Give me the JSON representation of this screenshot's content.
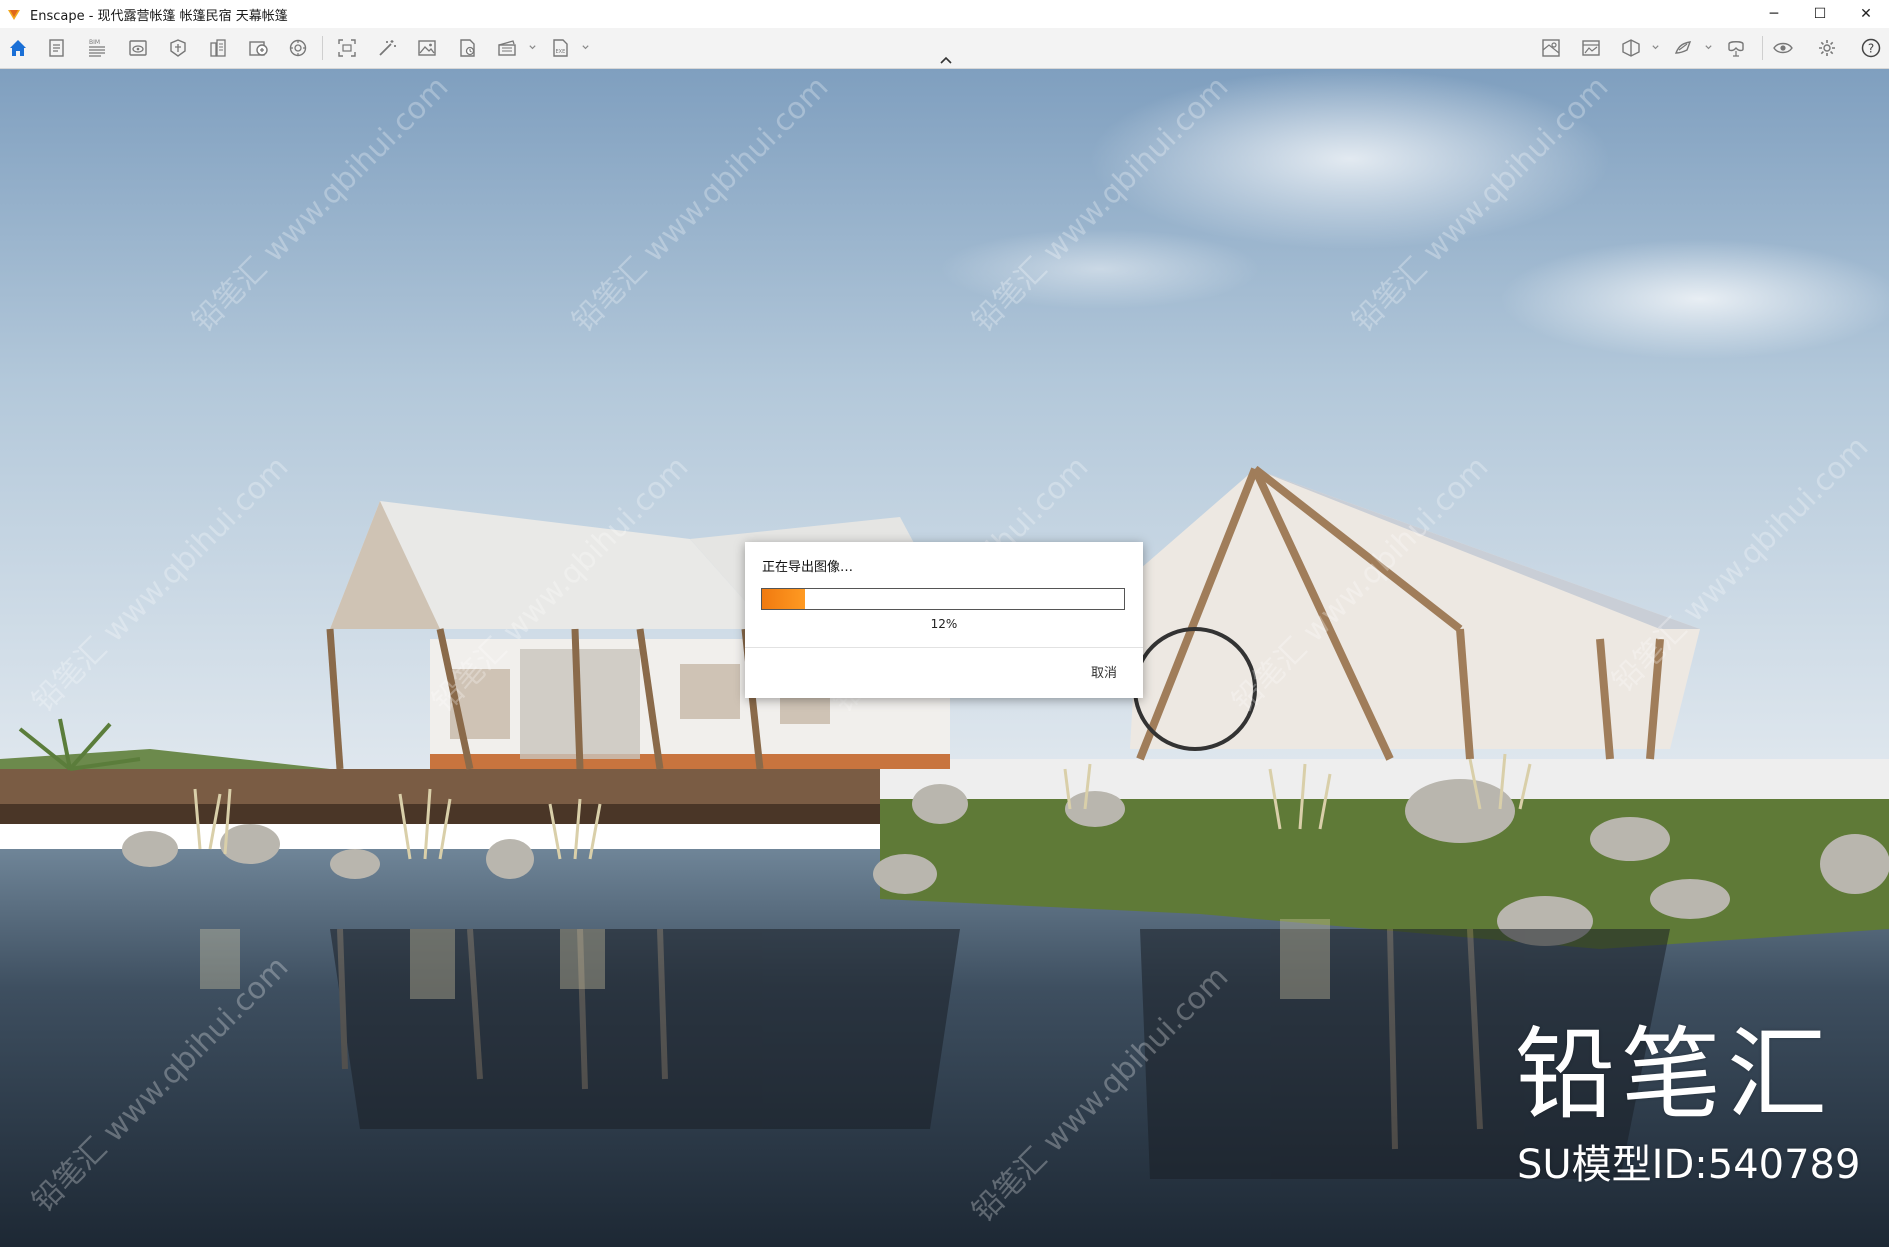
{
  "window": {
    "title": "Enscape - 现代露营帐篷 帐篷民宿 天幕帐篷",
    "controls": {
      "minimize": "─",
      "maximize": "☐",
      "close": "✕"
    }
  },
  "toolbar": {
    "left_icons": [
      "home-icon",
      "document-icon",
      "bim-list-icon",
      "view-icon",
      "asset-library-icon",
      "atlas-icon",
      "material-icon",
      "atmosphere-icon",
      "screenshot-icon",
      "magic-wand-icon",
      "image-export-icon",
      "batch-render-icon",
      "video-export-icon",
      "exe-export-icon"
    ],
    "right_icons": [
      "settings-map-icon",
      "visual-settings-icon",
      "cube-icon",
      "sketch-icon",
      "vr-icon",
      "eye-icon",
      "gear-icon",
      "help-icon"
    ],
    "help_label": "?",
    "bim_label": "BIM",
    "exe_label": "EXE",
    "accent_color": "#1a6fd6"
  },
  "dialog": {
    "title": "正在导出图像…",
    "progress_fraction": 0.12,
    "progress_label": "12%",
    "cancel_label": "取消",
    "progress_color": "#f07a10"
  },
  "watermark": {
    "brand": "铅笔汇",
    "model_id": "SU模型ID:540789",
    "repeat_text": "铅笔汇 www.qbihui.com"
  }
}
